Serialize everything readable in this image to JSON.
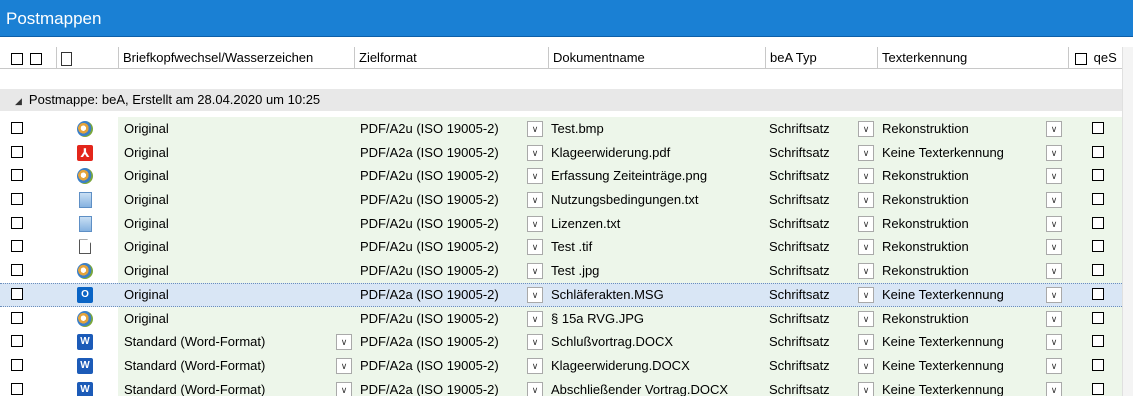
{
  "window": {
    "title": "Postmappen"
  },
  "columns": {
    "briefkopf": "Briefkopfwechsel/Wasserzeichen",
    "zielformat": "Zielformat",
    "dokumentname": "Dokumentname",
    "bea_typ": "beA Typ",
    "texterkennung": "Texterkennung",
    "qes": "qeS"
  },
  "group": {
    "label": "Postmappe: beA, Erstellt am 28.04.2020 um 10:25"
  },
  "rows": [
    {
      "icon": "paint-icon",
      "briefkopf": "Original",
      "zielformat": "PDF/A2u (ISO 19005-2)",
      "dokumentname": "Test.bmp",
      "bea_typ": "Schriftsatz",
      "texterkennung": "Rekonstruktion",
      "selected": false,
      "briefkopf_dropdown": false
    },
    {
      "icon": "pdf-icon",
      "briefkopf": "Original",
      "zielformat": "PDF/A2a (ISO 19005-2)",
      "dokumentname": "Klageerwiderung.pdf",
      "bea_typ": "Schriftsatz",
      "texterkennung": "Keine Texterkennung",
      "selected": false,
      "briefkopf_dropdown": false
    },
    {
      "icon": "paint-icon",
      "briefkopf": "Original",
      "zielformat": "PDF/A2u (ISO 19005-2)",
      "dokumentname": "Erfassung Zeiteinträge.png",
      "bea_typ": "Schriftsatz",
      "texterkennung": "Rekonstruktion",
      "selected": false,
      "briefkopf_dropdown": false
    },
    {
      "icon": "text-file-icon",
      "briefkopf": "Original",
      "zielformat": "PDF/A2u (ISO 19005-2)",
      "dokumentname": "Nutzungsbedingungen.txt",
      "bea_typ": "Schriftsatz",
      "texterkennung": "Rekonstruktion",
      "selected": false,
      "briefkopf_dropdown": false
    },
    {
      "icon": "text-file-icon",
      "briefkopf": "Original",
      "zielformat": "PDF/A2u (ISO 19005-2)",
      "dokumentname": "Lizenzen.txt",
      "bea_typ": "Schriftsatz",
      "texterkennung": "Rekonstruktion",
      "selected": false,
      "briefkopf_dropdown": false
    },
    {
      "icon": "blank-file-icon",
      "briefkopf": "Original",
      "zielformat": "PDF/A2u (ISO 19005-2)",
      "dokumentname": "Test .tif",
      "bea_typ": "Schriftsatz",
      "texterkennung": "Rekonstruktion",
      "selected": false,
      "briefkopf_dropdown": false
    },
    {
      "icon": "paint-icon",
      "briefkopf": "Original",
      "zielformat": "PDF/A2u (ISO 19005-2)",
      "dokumentname": "Test .jpg",
      "bea_typ": "Schriftsatz",
      "texterkennung": "Rekonstruktion",
      "selected": false,
      "briefkopf_dropdown": false
    },
    {
      "icon": "outlook-icon",
      "briefkopf": "Original",
      "zielformat": "PDF/A2a (ISO 19005-2)",
      "dokumentname": "Schläferakten.MSG",
      "bea_typ": "Schriftsatz",
      "texterkennung": "Keine Texterkennung",
      "selected": true,
      "briefkopf_dropdown": false
    },
    {
      "icon": "paint-icon",
      "briefkopf": "Original",
      "zielformat": "PDF/A2u (ISO 19005-2)",
      "dokumentname": "§ 15a RVG.JPG",
      "bea_typ": "Schriftsatz",
      "texterkennung": "Rekonstruktion",
      "selected": false,
      "briefkopf_dropdown": false
    },
    {
      "icon": "word-icon",
      "briefkopf": "Standard (Word-Format)",
      "zielformat": "PDF/A2a (ISO 19005-2)",
      "dokumentname": "Schlußvortrag.DOCX",
      "bea_typ": "Schriftsatz",
      "texterkennung": "Keine Texterkennung",
      "selected": false,
      "briefkopf_dropdown": true
    },
    {
      "icon": "word-icon",
      "briefkopf": "Standard (Word-Format)",
      "zielformat": "PDF/A2a (ISO 19005-2)",
      "dokumentname": "Klageerwiderung.DOCX",
      "bea_typ": "Schriftsatz",
      "texterkennung": "Keine Texterkennung",
      "selected": false,
      "briefkopf_dropdown": true
    },
    {
      "icon": "word-icon",
      "briefkopf": "Standard (Word-Format)",
      "zielformat": "PDF/A2a (ISO 19005-2)",
      "dokumentname": "Abschließender Vortrag.DOCX",
      "bea_typ": "Schriftsatz",
      "texterkennung": "Keine Texterkennung",
      "selected": false,
      "briefkopf_dropdown": true
    }
  ],
  "colors": {
    "titlebar": "#1a80d4",
    "selected_row": "#d9e6f5",
    "row_band": "#edf6ea",
    "group_band": "#e8e8e8"
  }
}
